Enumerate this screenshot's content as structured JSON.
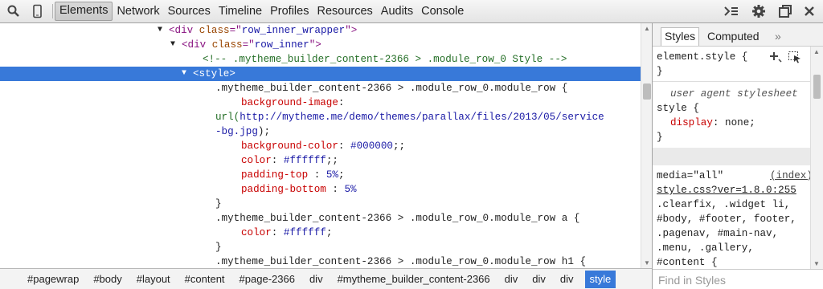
{
  "toolbar": {
    "tabs": [
      "Elements",
      "Network",
      "Sources",
      "Timeline",
      "Profiles",
      "Resources",
      "Audits",
      "Console"
    ],
    "selected_tab": "Elements",
    "icons": [
      "search-icon",
      "device-mode-icon",
      "show-drawer-icon",
      "gear-icon",
      "dock-side-icon",
      "close-icon"
    ]
  },
  "dom": {
    "lines": [
      {
        "indent": 210,
        "tri": "▼",
        "parts": [
          [
            "tag",
            "<div "
          ],
          [
            "attr",
            "class"
          ],
          [
            "tag",
            "=\""
          ],
          [
            "val",
            "row_inner_wrapper"
          ],
          [
            "tag",
            "\">"
          ]
        ]
      },
      {
        "indent": 226,
        "tri": "▼",
        "parts": [
          [
            "tag",
            "<div "
          ],
          [
            "attr",
            "class"
          ],
          [
            "tag",
            "=\""
          ],
          [
            "val",
            "row_inner"
          ],
          [
            "tag",
            "\">"
          ]
        ]
      },
      {
        "indent": 252,
        "tri": "",
        "parts": [
          [
            "cmt",
            "<!-- .mytheme_builder_content-2366 > .module_row_0 Style -->"
          ]
        ]
      },
      {
        "indent": 240,
        "tri": "▼",
        "selected": true,
        "parts": [
          [
            "tag",
            "<style>"
          ]
        ]
      },
      {
        "indent": 268,
        "tri": "",
        "parts": [
          [
            "plain",
            ".mytheme_builder_content-2366 > .module_row_0.module_row {"
          ]
        ]
      },
      {
        "indent": 300,
        "tri": "",
        "parts": [
          [
            "prop",
            "background-image"
          ],
          [
            "plain",
            ":"
          ]
        ]
      },
      {
        "indent": 268,
        "tri": "",
        "parts": [
          [
            "cmt",
            "url("
          ],
          [
            "val",
            "http://mytheme.me/demo/themes/parallax/files/2013/05/service"
          ]
        ]
      },
      {
        "indent": 268,
        "tri": "",
        "parts": [
          [
            "val",
            "-bg.jpg"
          ],
          [
            "plain",
            ");"
          ]
        ]
      },
      {
        "indent": 300,
        "tri": "",
        "parts": [
          [
            "prop",
            "background-color"
          ],
          [
            "plain",
            ": "
          ],
          [
            "val",
            "#000000"
          ],
          [
            "plain",
            ";;"
          ]
        ]
      },
      {
        "indent": 300,
        "tri": "",
        "parts": [
          [
            "prop",
            "color"
          ],
          [
            "plain",
            ": "
          ],
          [
            "val",
            "#ffffff"
          ],
          [
            "plain",
            ";;"
          ]
        ]
      },
      {
        "indent": 300,
        "tri": "",
        "parts": [
          [
            "prop",
            "padding-top"
          ],
          [
            "plain",
            " : "
          ],
          [
            "val",
            "5%"
          ],
          [
            "plain",
            ";"
          ]
        ]
      },
      {
        "indent": 300,
        "tri": "",
        "parts": [
          [
            "prop",
            "padding-bottom"
          ],
          [
            "plain",
            " : "
          ],
          [
            "val",
            "5%"
          ]
        ]
      },
      {
        "indent": 268,
        "tri": "",
        "parts": [
          [
            "plain",
            "}"
          ]
        ]
      },
      {
        "indent": 268,
        "tri": "",
        "parts": [
          [
            "plain",
            ".mytheme_builder_content-2366 > .module_row_0.module_row a {"
          ]
        ]
      },
      {
        "indent": 300,
        "tri": "",
        "parts": [
          [
            "prop",
            "color"
          ],
          [
            "plain",
            ": "
          ],
          [
            "val",
            "#ffffff"
          ],
          [
            "plain",
            ";"
          ]
        ]
      },
      {
        "indent": 268,
        "tri": "",
        "parts": [
          [
            "plain",
            "}"
          ]
        ]
      },
      {
        "indent": 268,
        "tri": "",
        "parts": [
          [
            "plain",
            ".mytheme_builder_content-2366 > .module_row_0.module_row h1 {"
          ]
        ]
      }
    ]
  },
  "styles": {
    "tabs": [
      "Styles",
      "Computed",
      "»"
    ],
    "element_style": "element.style {",
    "element_style_close": "}",
    "ua_label": "user agent stylesheet",
    "ua_selector": "style {",
    "ua_prop": "display",
    "ua_value": "none;",
    "ua_close": "}",
    "media": "media=\"all\"",
    "source_link": "(index)",
    "stylesheet_link": "style.css?ver=1.8.0:255",
    "selectors": [
      ".clearfix, .widget li,",
      "#body, #footer, footer,",
      ".pagenav, #main-nav,",
      ".menu, .gallery,",
      "#content {"
    ],
    "find_placeholder": "Find in Styles"
  },
  "breadcrumbs": {
    "items": [
      "#pagewrap",
      "#body",
      "#layout",
      "#content",
      "#page-2366",
      "div",
      "#mytheme_builder_content-2366",
      "div",
      "div",
      "div",
      "style"
    ],
    "selected": "style"
  }
}
